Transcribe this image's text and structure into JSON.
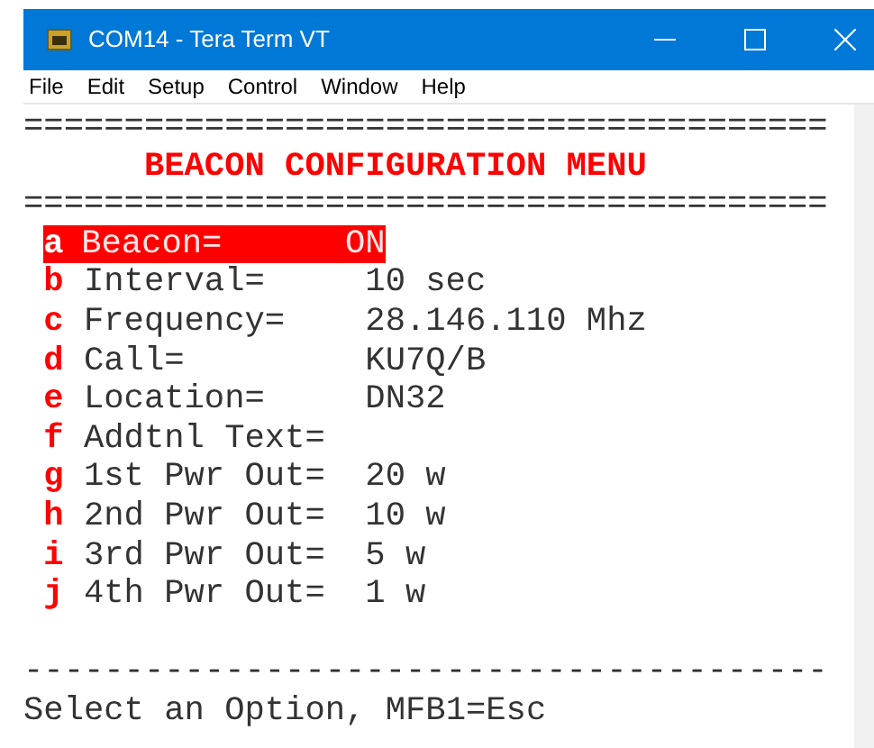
{
  "window": {
    "title": "COM14 - Tera Term VT"
  },
  "menu": [
    "File",
    "Edit",
    "Setup",
    "Control",
    "Window",
    "Help"
  ],
  "terminal": {
    "top_rule": "========================================",
    "heading": "BEACON CONFIGURATION MENU",
    "heading_rule": "========================================",
    "options": [
      {
        "key": "a",
        "label": "Beacon=",
        "value": "ON",
        "selected": true
      },
      {
        "key": "b",
        "label": "Interval=",
        "value": "10 sec",
        "selected": false
      },
      {
        "key": "c",
        "label": "Frequency=",
        "value": "28.146.110 Mhz",
        "selected": false
      },
      {
        "key": "d",
        "label": "Call=",
        "value": "KU7Q/B",
        "selected": false
      },
      {
        "key": "e",
        "label": "Location=",
        "value": "DN32",
        "selected": false
      },
      {
        "key": "f",
        "label": "Addtnl Text=",
        "selected": false
      },
      {
        "key": "g",
        "label": "1st Pwr Out=",
        "value": "20 w",
        "selected": false
      },
      {
        "key": "h",
        "label": "2nd Pwr Out=",
        "value": "10 w",
        "selected": false
      },
      {
        "key": "i",
        "label": "3rd Pwr Out=",
        "value": "5 w",
        "selected": false
      },
      {
        "key": "j",
        "label": "4th Pwr Out=",
        "value": "1 w",
        "selected": false
      }
    ],
    "bottom_rule": "----------------------------------------",
    "prompt": "Select an Option, MFB1=Esc"
  }
}
